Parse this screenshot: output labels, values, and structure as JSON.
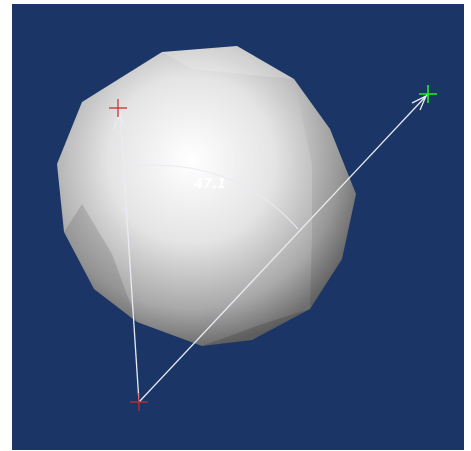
{
  "viewport": {
    "background_color": "#1b3566",
    "object_color": "#e8e8e8"
  },
  "measurement": {
    "angle_value": "47.1",
    "line_color": "#e8ecf2",
    "label_color": "#ffffff",
    "vertex_marker_color": "#cc2a2a",
    "start_marker_color": "#cc2a2a",
    "end_marker_color": "#22ee22"
  }
}
